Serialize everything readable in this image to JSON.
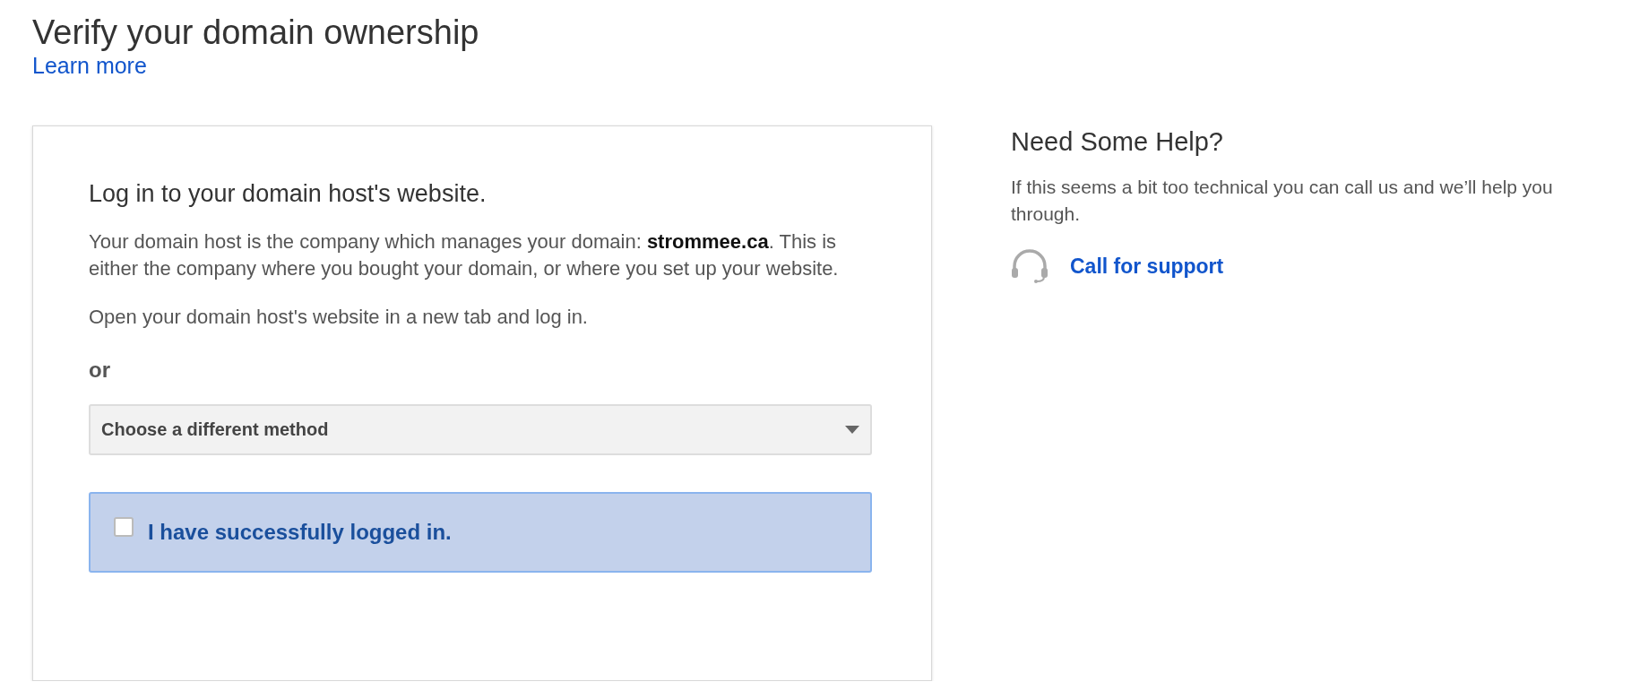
{
  "header": {
    "title": "Verify your domain ownership",
    "link": "Learn more"
  },
  "card": {
    "heading": "Log in to your domain host's website.",
    "paragraphs": [
      "Your domain host is the company which manages your domain: **strommee.ca**. This is either the company where you bought your domain, or where you set up your website.",
      "Open your domain host's website in a new tab and log in."
    ],
    "or_label": "or",
    "method_dropdown": {
      "value": "Choose a different method"
    },
    "confirmation": {
      "label": "I have successfully logged in.",
      "checked": false
    }
  },
  "help": {
    "title": "Need Some Help?",
    "text": "If this seems a bit too technical you can call us and we’ll help you through.",
    "link": "Call for support"
  }
}
